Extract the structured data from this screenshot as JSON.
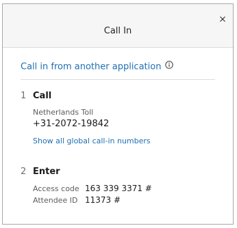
{
  "dialog": {
    "title": "Call In",
    "close_label": "×"
  },
  "call_in_link": "Call in from another application",
  "steps": [
    {
      "number": "1",
      "title": "Call",
      "country": "Netherlands Toll",
      "phone": "+31-2072-19842",
      "global_link": "Show all global call-in numbers"
    },
    {
      "number": "2",
      "title": "Enter",
      "access_code_label": "Access code",
      "access_code_value": "163 339 3371 #",
      "attendee_id_label": "Attendee ID",
      "attendee_id_value": "11373 #"
    }
  ],
  "icons": {
    "close": "close-icon",
    "info": "info-icon"
  },
  "colors": {
    "link": "#1f6fb3",
    "header_bg": "#f6f6f6",
    "border": "#a8a8a8"
  }
}
